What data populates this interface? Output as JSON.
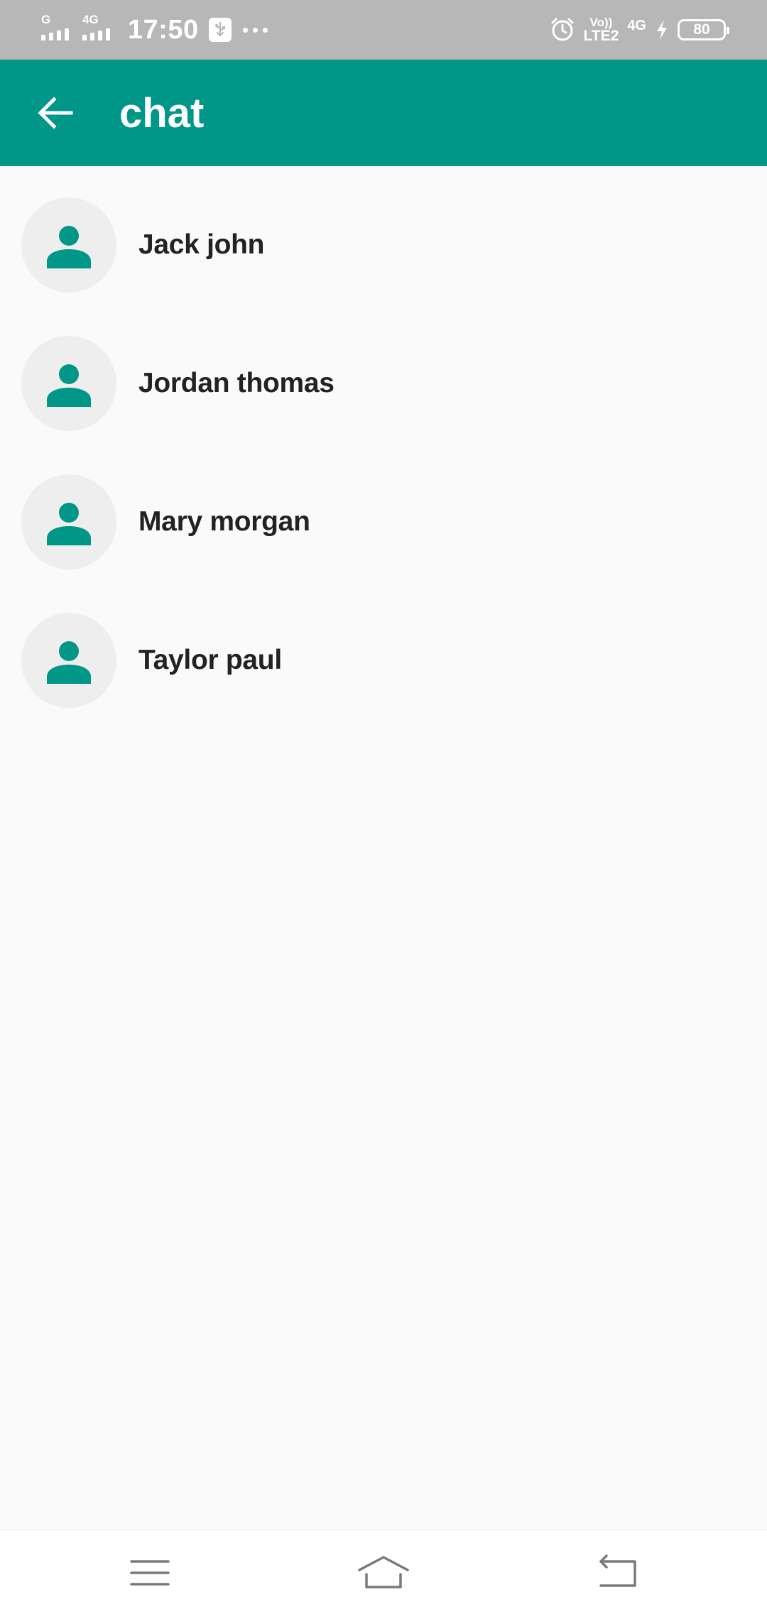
{
  "status_bar": {
    "sim1_network": "G",
    "sim2_network": "4G",
    "time": "17:50",
    "volte_top": "Vo))",
    "volte_bottom": "LTE2",
    "network2": "4G",
    "battery": "80",
    "icons": [
      "signal-icon",
      "usb-icon",
      "more-dots-icon",
      "alarm-icon",
      "charging-icon",
      "battery-icon"
    ]
  },
  "app_bar": {
    "title": "chat",
    "back_icon": "arrow-back-icon",
    "background": "#009688"
  },
  "contacts": [
    {
      "name": "Jack john"
    },
    {
      "name": "Jordan thomas"
    },
    {
      "name": "Mary morgan"
    },
    {
      "name": "Taylor paul"
    }
  ],
  "avatar_icon": "person-icon",
  "colors": {
    "accent": "#009688",
    "avatar_bg": "#eeeeee",
    "text": "#222222",
    "background": "#fafafa"
  },
  "nav_bar": {
    "icons": [
      "menu-icon",
      "home-icon",
      "back-icon"
    ]
  }
}
